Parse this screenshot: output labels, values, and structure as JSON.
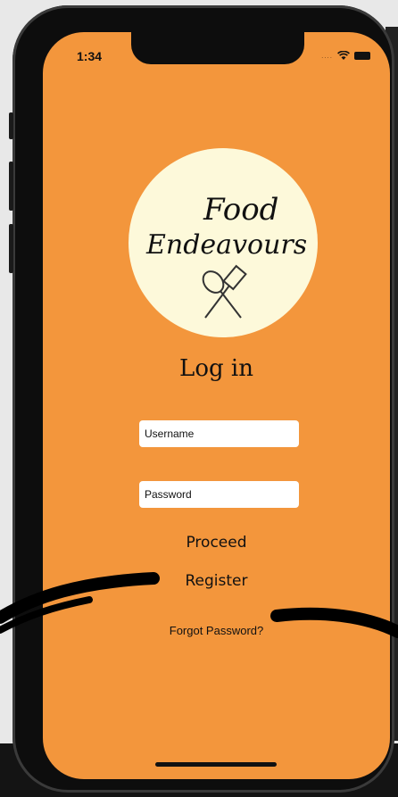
{
  "status_bar": {
    "time": "1:34",
    "dots": "...."
  },
  "logo": {
    "word1": "Food",
    "word2": "Endeavours"
  },
  "login": {
    "title": "Log in",
    "username_placeholder": "Username",
    "password_placeholder": "Password",
    "proceed_label": "Proceed",
    "register_label": "Register",
    "forgot_label": "Forgot Password?"
  },
  "colors": {
    "screen_bg": "#f3963c",
    "logo_bg": "#fdf9da"
  }
}
